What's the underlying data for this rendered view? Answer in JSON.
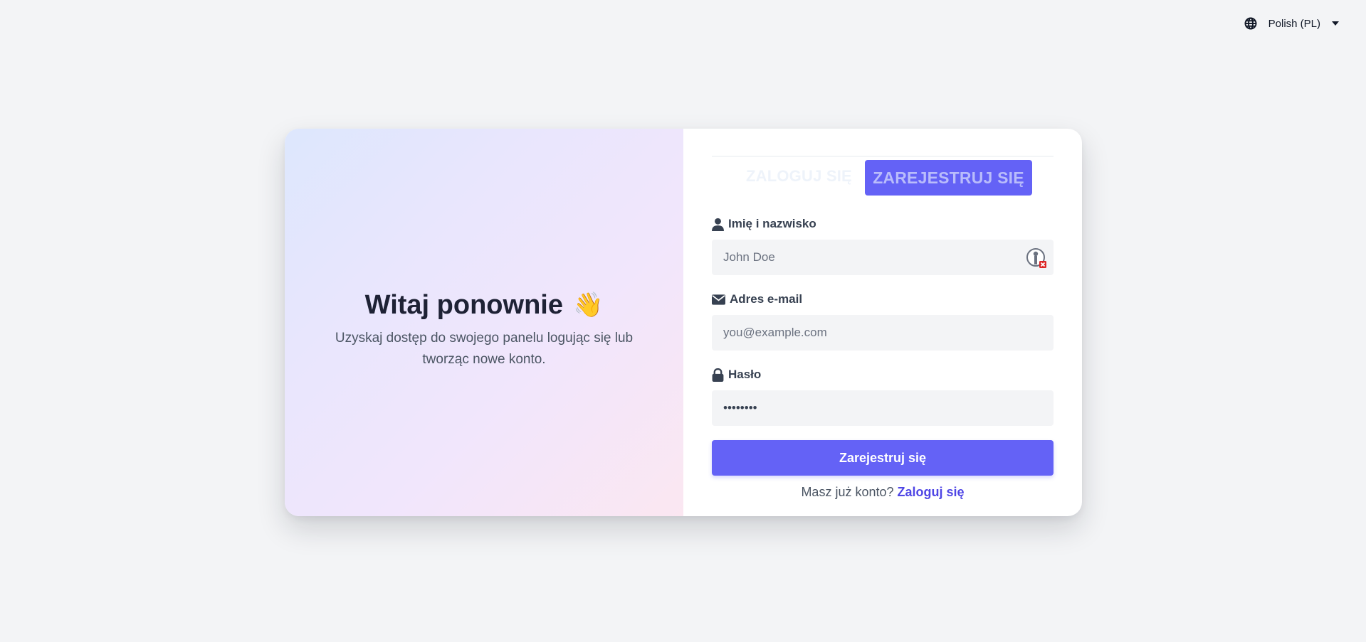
{
  "language": {
    "label": "Polish (PL)",
    "icon": "globe-icon"
  },
  "hero": {
    "title": "Witaj ponownie",
    "emoji": "👋",
    "subtitle": "Uzyskaj dostęp do swojego panelu logując się lub tworząc nowe konto."
  },
  "tabs": {
    "login": "ZALOGUJ SIĘ",
    "register": "ZAREJESTRUJ SIĘ",
    "active": "register"
  },
  "form": {
    "name": {
      "label": "Imię i nazwisko",
      "placeholder": "John Doe",
      "value": "",
      "icon": "user-icon"
    },
    "email": {
      "label": "Adres e-mail",
      "placeholder": "you@example.com",
      "value": "",
      "icon": "envelope-icon"
    },
    "password": {
      "label": "Hasło",
      "value": "••••••••",
      "icon": "lock-icon"
    },
    "submit_label": "Zarejestruj się",
    "footer_text": "Masz już konto?",
    "footer_link": "Zaloguj się"
  },
  "colors": {
    "accent": "#6462f6",
    "link": "#4f46e5",
    "background": "#f3f4f6"
  }
}
